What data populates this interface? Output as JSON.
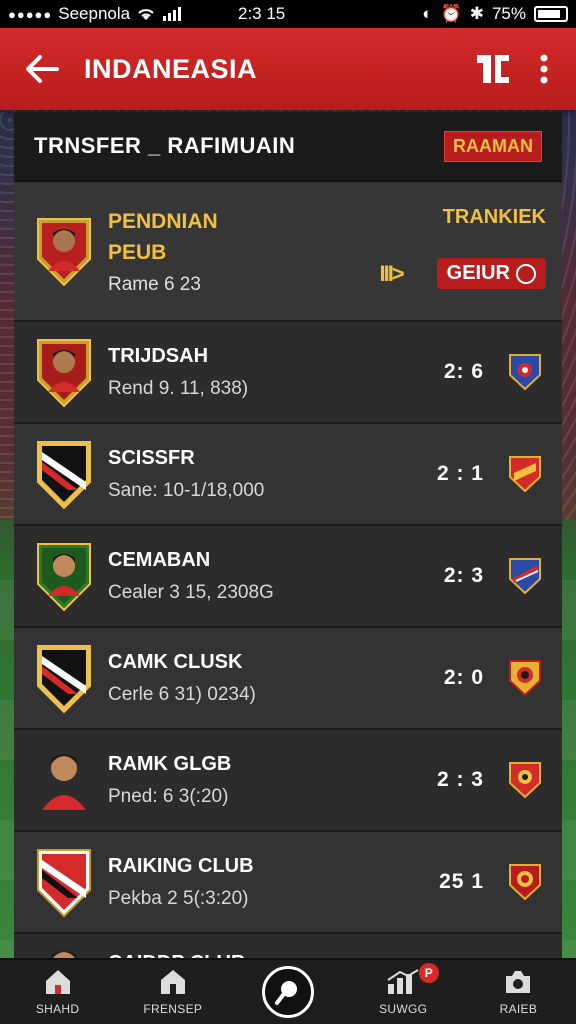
{
  "status_bar": {
    "carrier": "Seepnola",
    "time": "2:3 15",
    "battery": "75%"
  },
  "app_bar": {
    "title": "INDANEASIA"
  },
  "panel": {
    "title": "TRNSFER _ RAFIMUAIN",
    "badge": "RAAMAN"
  },
  "featured": {
    "name_line1": "PENDNIAN",
    "name_line2": "PEUB",
    "sub": "Rame 6 23",
    "right_label": "TRANKIEK",
    "indicator": "III>",
    "badge": "GEIUR"
  },
  "rows": [
    {
      "name": "TRIJDSAH",
      "sub": "Rend 9. 11, 838)",
      "score": "2: 6"
    },
    {
      "name": "SCISSFR",
      "sub": "Sane: 10-1/18,000",
      "score": "2 : 1"
    },
    {
      "name": "CEMABAN",
      "sub": "Cealer 3 15, 2308G",
      "score": "2: 3"
    },
    {
      "name": "CAMK CLUSK",
      "sub": "Cerle 6 31) 0234)",
      "score": "2: 0"
    },
    {
      "name": "RAMK GLGB",
      "sub": "Pned: 6 3(:20)",
      "score": "2 : 3"
    },
    {
      "name": "RAIKING CLUB",
      "sub": "Pekba 2 5(:3:20)",
      "score": "25 1"
    },
    {
      "name": "CAIDDP CLUB",
      "sub": "",
      "score": ""
    }
  ],
  "bottom_nav": [
    {
      "label": "SHAHD",
      "icon": "home-icon"
    },
    {
      "label": "FRENSEP",
      "icon": "house-icon"
    },
    {
      "label": "",
      "icon": "search-icon"
    },
    {
      "label": "SUWGG",
      "icon": "chart-icon",
      "badge": "P"
    },
    {
      "label": "RAIEB",
      "icon": "camera-icon"
    }
  ],
  "colors": {
    "app_bar": "#c92222",
    "accent": "#f0c040",
    "panel": "#2b2b2b"
  }
}
